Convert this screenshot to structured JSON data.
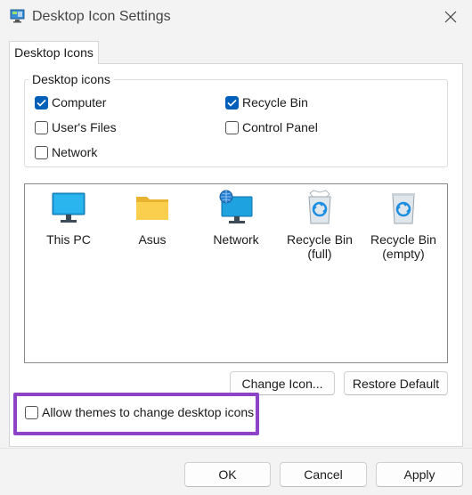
{
  "window": {
    "title": "Desktop Icon Settings",
    "icon": "desktop-settings-icon"
  },
  "tabs": [
    {
      "label": "Desktop Icons",
      "selected": true
    }
  ],
  "desktop_icons_group": {
    "title": "Desktop icons",
    "checkboxes": [
      {
        "label": "Computer",
        "checked": true
      },
      {
        "label": "Recycle Bin",
        "checked": true
      },
      {
        "label": "User's Files",
        "checked": false
      },
      {
        "label": "Control Panel",
        "checked": false
      },
      {
        "label": "Network",
        "checked": false
      }
    ]
  },
  "icon_list": [
    {
      "label": "This PC",
      "icon": "monitor-icon"
    },
    {
      "label": "Asus",
      "icon": "folder-icon"
    },
    {
      "label": "Network",
      "icon": "network-icon"
    },
    {
      "label": "Recycle Bin\n(full)",
      "icon": "recycle-bin-full-icon"
    },
    {
      "label": "Recycle Bin\n(empty)",
      "icon": "recycle-bin-empty-icon"
    }
  ],
  "buttons": {
    "change_icon": "Change Icon...",
    "restore_default": "Restore Default",
    "ok": "OK",
    "cancel": "Cancel",
    "apply": "Apply"
  },
  "allow_themes": {
    "label": "Allow themes to change desktop icons",
    "checked": false
  },
  "colors": {
    "accent": "#005fb8",
    "highlight": "#8d43c7"
  }
}
